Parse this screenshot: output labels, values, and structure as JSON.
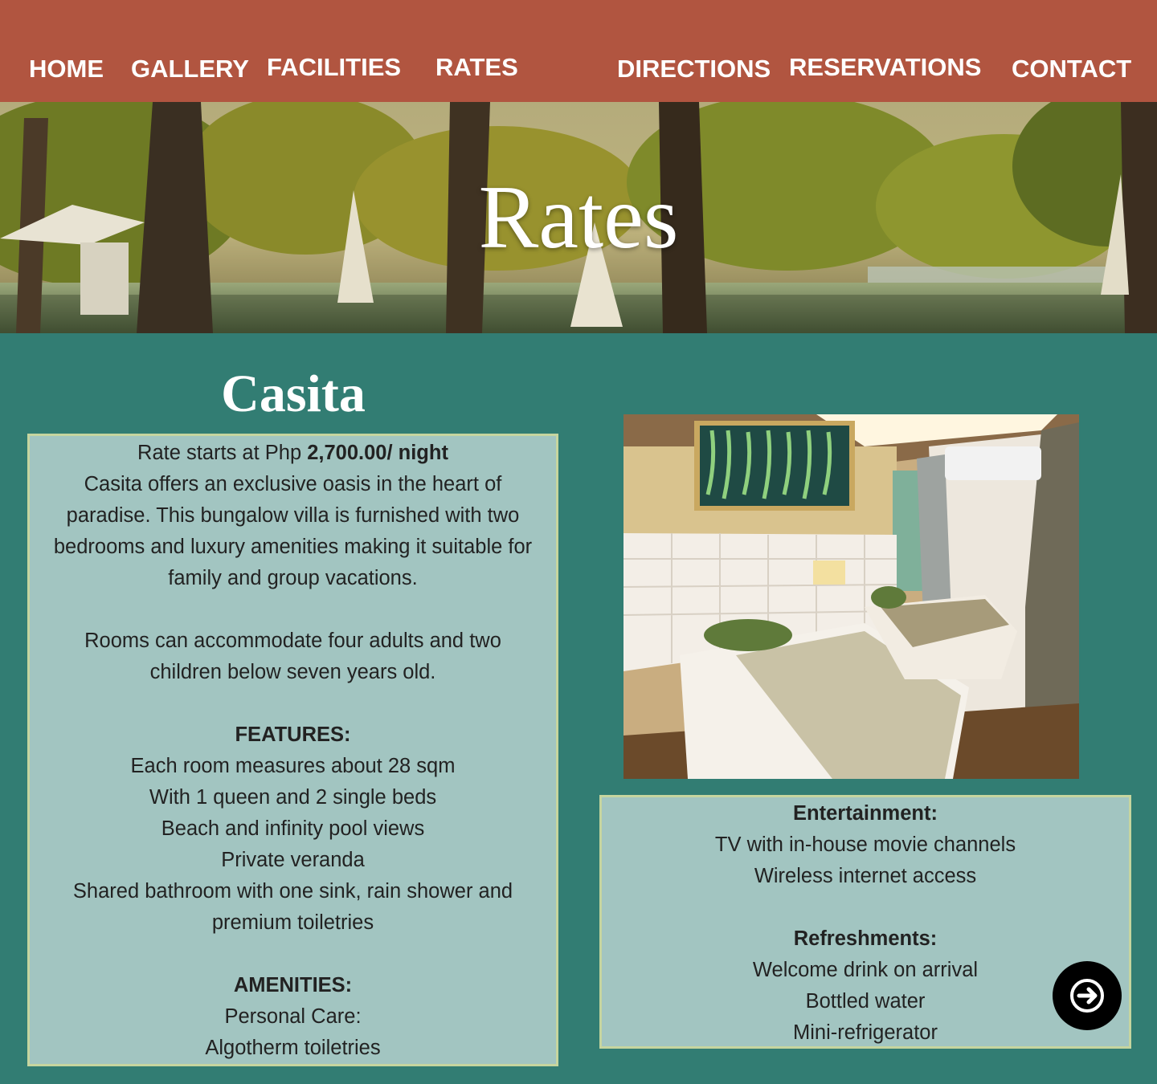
{
  "nav": {
    "items": [
      {
        "label": "HOME"
      },
      {
        "label": "GALLERY"
      },
      {
        "label": "FACILITIES"
      },
      {
        "label": "RATES"
      },
      {
        "label": "DIRECTIONS"
      },
      {
        "label": "RESERVATIONS"
      },
      {
        "label": "CONTACT"
      }
    ]
  },
  "hero": {
    "title": "Rates"
  },
  "casita": {
    "title": "Casita",
    "rate_prefix": "Rate starts at Php ",
    "rate_value": "2,700.00/ night",
    "description": [
      "Casita offers an exclusive oasis in the heart of",
      "paradise. This bungalow villa is furnished with two",
      "bedrooms and luxury amenities making it suitable for",
      "family and group vacations."
    ],
    "capacity": [
      "Rooms can accommodate four adults and two",
      "children below seven years old."
    ],
    "features_heading": "FEATURES:",
    "features": [
      "Each room measures about 28 sqm",
      "With 1 queen and 2 single beds",
      "Beach and infinity pool views",
      "Private veranda",
      "Shared bathroom with one sink, rain shower and",
      "premium toiletries"
    ],
    "amenities_heading": "AMENITIES:",
    "personal_care_label": "Personal Care:",
    "personal_care": [
      "Algotherm toiletries"
    ]
  },
  "extras": {
    "entertainment_heading": "Entertainment:",
    "entertainment": [
      "TV with in-house movie channels",
      "Wireless internet access"
    ],
    "refreshments_heading": "Refreshments:",
    "refreshments": [
      "Welcome drink on arrival",
      "Bottled water",
      "Mini-refrigerator"
    ]
  },
  "icons": {
    "next": "arrow-right-icon"
  },
  "colors": {
    "nav_bg": "#b15540",
    "page_bg": "#327d73",
    "card_bg": "#a2c5c1",
    "card_border": "#c6d59f"
  }
}
